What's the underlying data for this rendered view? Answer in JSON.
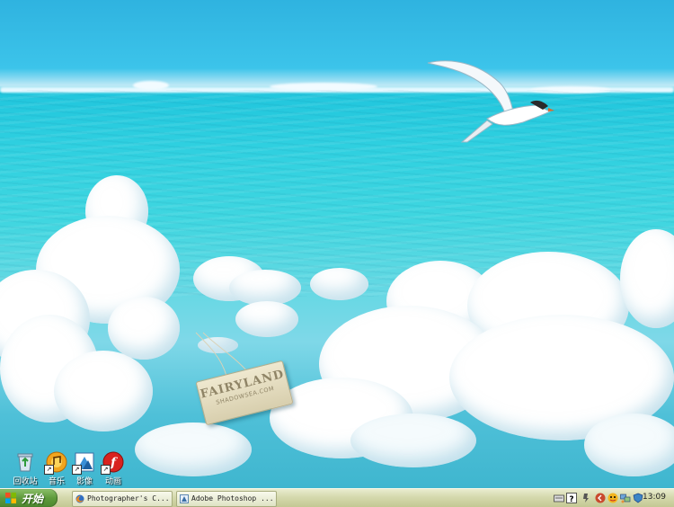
{
  "wallpaper": {
    "sign_line1": "FAIRYLAND",
    "sign_line2": "SHADOWSEA.COM"
  },
  "desktop_icons": [
    {
      "label": "回收站",
      "icon": "recycle-bin-icon"
    },
    {
      "label": "音乐",
      "icon": "music-icon"
    },
    {
      "label": "影像",
      "icon": "video-icon"
    },
    {
      "label": "动画",
      "icon": "flash-icon"
    }
  ],
  "taskbar": {
    "start_label": "开始",
    "tasks": [
      {
        "label": "Photographer's C...",
        "icon": "firefox-icon"
      },
      {
        "label": "Adobe Photoshop ...",
        "icon": "photoshop-icon"
      }
    ],
    "clock": "13:09"
  },
  "colors": {
    "sky": "#2fb3e0",
    "sea": "#2fd0e0",
    "taskbar": "#d5d9ad",
    "start_button": "#5f9b3c"
  }
}
